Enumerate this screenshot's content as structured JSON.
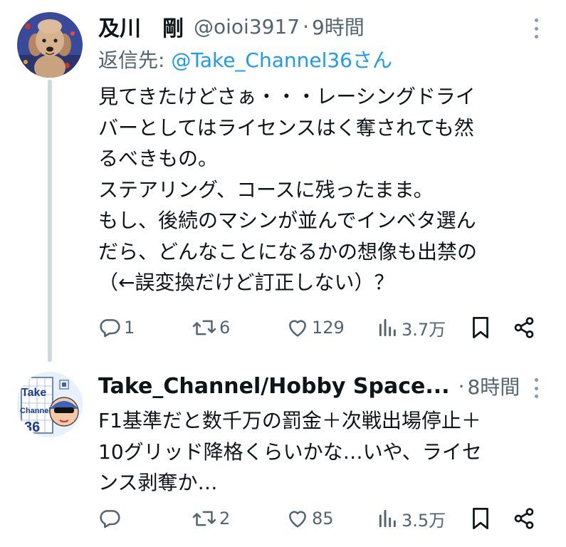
{
  "tweets": [
    {
      "author_name": "及川　剛",
      "handle": "@oioi3917",
      "separator": "·",
      "time": "9時間",
      "reply_to_prefix": "返信先: ",
      "reply_to_mention": "@Take_Channel36さん",
      "text": "見てきたけどさぁ・・・レーシングドライ\nバーとしてはライセンスはく奪されても然\nるべきもの。\nステアリング、コースに残ったまま。\nもし、後続のマシンが並んでインベタ選ん\nだら、どんなことになるかの想像も出禁の\n（←誤変換だけど訂正しない）？",
      "actions": {
        "reply_count": "1",
        "retweet_count": "6",
        "like_count": "129",
        "views_count": "3.7万"
      },
      "avatar_icon": "poodle-dog-photo"
    },
    {
      "author_name": "Take_Channel/Hobby Space...",
      "separator": "·",
      "time": "8時間",
      "text": "F1基準だと数千万の罰金＋次戦出場停止＋\n10グリッド降格くらいかな…いや、ライセ\nンス剥奪か…",
      "actions": {
        "reply_count": "",
        "retweet_count": "2",
        "like_count": "85",
        "views_count": "3.5万"
      },
      "avatar_icon": "take-channel-logo",
      "avatar_logo_text": [
        "Take",
        "Channel",
        "36"
      ]
    }
  ],
  "colors": {
    "text": "#0f1419",
    "secondary": "#536471",
    "link": "#1d9bf0",
    "thread_line": "#cfd9de"
  }
}
